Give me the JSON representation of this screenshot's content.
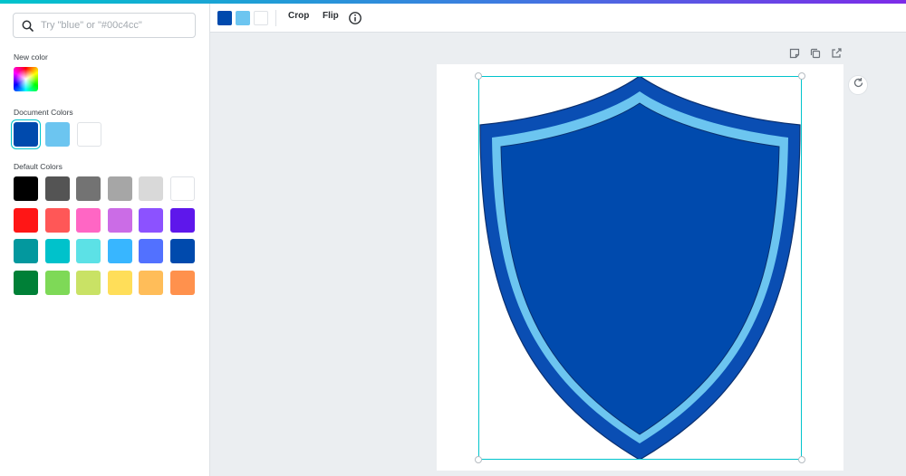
{
  "search": {
    "placeholder": "Try \"blue\" or \"#00c4cc\"",
    "value": ""
  },
  "sections": {
    "new_color": "New color",
    "document_colors": "Document Colors",
    "default_colors": "Default Colors"
  },
  "document_colors": [
    "#004aad",
    "#6cc5f0",
    "#ffffff"
  ],
  "default_colors": [
    [
      "#000000",
      "#545454",
      "#737373",
      "#a6a6a6",
      "#d9d9d9",
      "#ffffff"
    ],
    [
      "#ff1616",
      "#ff5757",
      "#ff66c4",
      "#cb6ce6",
      "#8c52ff",
      "#5e17eb"
    ],
    [
      "#03989e",
      "#00c2cb",
      "#5ce1e6",
      "#38b6ff",
      "#5271ff",
      "#004aad"
    ],
    [
      "#008037",
      "#7ed957",
      "#c9e265",
      "#ffde59",
      "#ffbd59",
      "#ff914d"
    ]
  ],
  "toolbar": {
    "colors": [
      "#004aad",
      "#6cc5f0",
      "#ffffff"
    ],
    "crop_label": "Crop",
    "flip_label": "Flip"
  },
  "shield": {
    "outer_color": "#0a4eb3",
    "stripe_color": "#6cc5f0",
    "inner_color": "#004aad",
    "outline_color": "#0a2f6e"
  },
  "accent": "#00c4cc"
}
